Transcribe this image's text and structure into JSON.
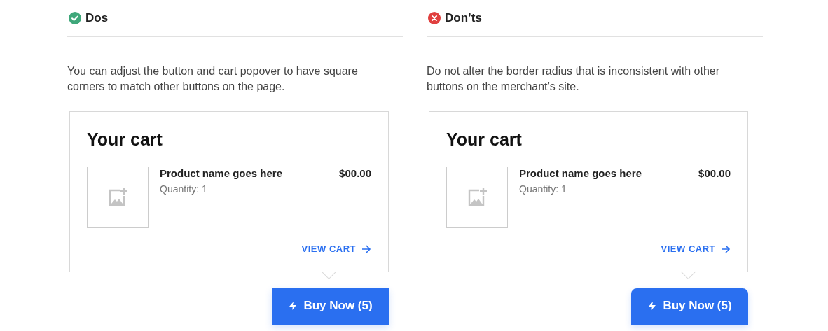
{
  "columns": [
    {
      "kind": "do",
      "heading": "Dos",
      "description": "You can adjust the button and cart popover to have square corners to match other buttons on the page.",
      "cart": {
        "title": "Your cart",
        "product_name": "Product name goes here",
        "quantity": "Quantity: 1",
        "price": "$00.00",
        "link": "VIEW CART"
      },
      "button": {
        "label": "Buy Now (5)",
        "rounded": false
      }
    },
    {
      "kind": "dont",
      "heading": "Don’ts",
      "description": "Do not alter the border radius that is inconsistent with other buttons on the merchant’s site.",
      "cart": {
        "title": "Your cart",
        "product_name": "Product name goes here",
        "quantity": "Quantity: 1",
        "price": "$00.00",
        "link": "VIEW CART"
      },
      "button": {
        "label": "Buy Now (5)",
        "rounded": true
      }
    }
  ]
}
